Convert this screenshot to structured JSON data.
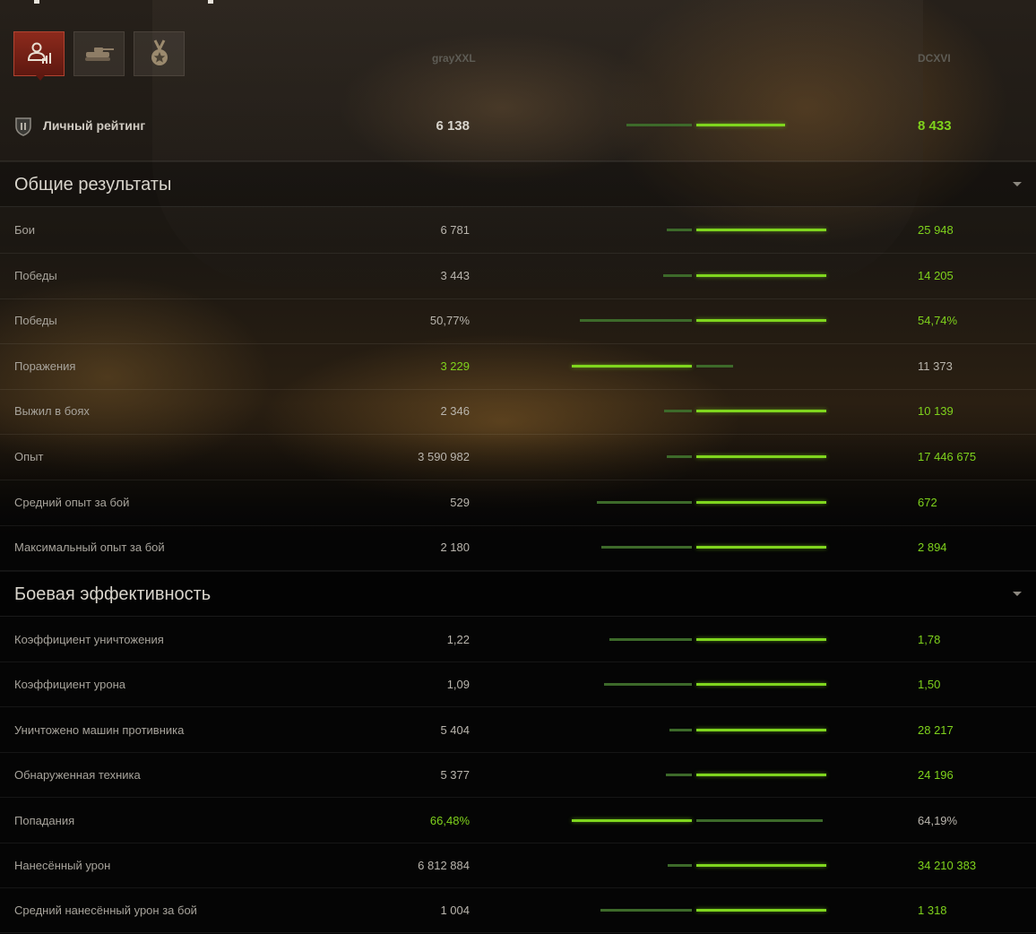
{
  "tabs": [
    {
      "name": "personal",
      "icon": "player-stats-icon",
      "active": true
    },
    {
      "name": "vehicles",
      "icon": "tank-icon",
      "active": false
    },
    {
      "name": "awards",
      "icon": "medal-icon",
      "active": false
    }
  ],
  "players": {
    "left": "grayXXL",
    "right": "DCXVI"
  },
  "rating": {
    "label": "Личный рейтинг",
    "left": "6 138",
    "right": "8 433",
    "left_ratio": 0.73,
    "right_ratio": 1.0,
    "winner": "right"
  },
  "sections": [
    {
      "title": "Общие результаты",
      "rows": [
        {
          "label": "Бои",
          "left": "6 781",
          "right": "25 948",
          "left_ratio": 0.21,
          "right_ratio": 1.0,
          "winner": "right"
        },
        {
          "label": "Победы",
          "left": "3 443",
          "right": "14 205",
          "left_ratio": 0.24,
          "right_ratio": 1.0,
          "winner": "right"
        },
        {
          "label": "Победы",
          "left": "50,77%",
          "right": "54,74%",
          "left_ratio": 0.93,
          "right_ratio": 1.0,
          "winner": "right"
        },
        {
          "label": "Поражения",
          "left": "3 229",
          "right": "11 373",
          "left_ratio": 1.0,
          "right_ratio": 0.28,
          "winner": "left"
        },
        {
          "label": "Выжил в боях",
          "left": "2 346",
          "right": "10 139",
          "left_ratio": 0.23,
          "right_ratio": 1.0,
          "winner": "right"
        },
        {
          "label": "Опыт",
          "left": "3 590 982",
          "right": "17 446 675",
          "left_ratio": 0.21,
          "right_ratio": 1.0,
          "winner": "right"
        },
        {
          "label": "Средний опыт за бой",
          "left": "529",
          "right": "672",
          "left_ratio": 0.79,
          "right_ratio": 1.0,
          "winner": "right"
        },
        {
          "label": "Максимальный опыт за бой",
          "left": "2 180",
          "right": "2 894",
          "left_ratio": 0.75,
          "right_ratio": 1.0,
          "winner": "right"
        }
      ]
    },
    {
      "title": "Боевая эффективность",
      "rows": [
        {
          "label": "Коэффициент уничтожения",
          "left": "1,22",
          "right": "1,78",
          "left_ratio": 0.69,
          "right_ratio": 1.0,
          "winner": "right"
        },
        {
          "label": "Коэффициент урона",
          "left": "1,09",
          "right": "1,50",
          "left_ratio": 0.73,
          "right_ratio": 1.0,
          "winner": "right"
        },
        {
          "label": "Уничтожено машин противника",
          "left": "5 404",
          "right": "28 217",
          "left_ratio": 0.19,
          "right_ratio": 1.0,
          "winner": "right"
        },
        {
          "label": "Обнаруженная техника",
          "left": "5 377",
          "right": "24 196",
          "left_ratio": 0.22,
          "right_ratio": 1.0,
          "winner": "right"
        },
        {
          "label": "Попадания",
          "left": "66,48%",
          "right": "64,19%",
          "left_ratio": 1.0,
          "right_ratio": 0.97,
          "winner": "left"
        },
        {
          "label": "Нанесённый урон",
          "left": "6 812 884",
          "right": "34 210 383",
          "left_ratio": 0.2,
          "right_ratio": 1.0,
          "winner": "right"
        },
        {
          "label": "Средний нанесённый урон за бой",
          "left": "1 004",
          "right": "1 318",
          "left_ratio": 0.76,
          "right_ratio": 1.0,
          "winner": "right"
        }
      ]
    }
  ],
  "colors": {
    "win": "#7fd21c",
    "win_bar": "#7fd61e",
    "lose_bar": "#3d6a2a",
    "active_tab": "#8c2a1c"
  }
}
